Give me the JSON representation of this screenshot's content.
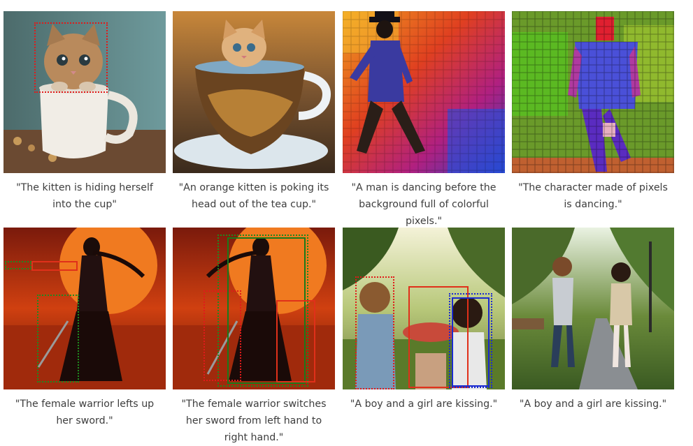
{
  "cards": [
    {
      "caption": "\"The kitten is hiding herself into the cup\""
    },
    {
      "caption": "\"An orange kitten is poking its head out of the tea cup.\""
    },
    {
      "caption": "\"A man is dancing before the background full of colorful pixels.\""
    },
    {
      "caption": "\"The character made of pixels is dancing.\""
    },
    {
      "caption": "\"The female warrior lefts up her sword.\""
    },
    {
      "caption": "\"The female warrior switches her sword from left hand to right hand.\""
    },
    {
      "caption": "\"A boy and a girl are kissing.\""
    },
    {
      "caption": "\"A boy and a girl are kissing.\""
    }
  ],
  "colors": {
    "box_red": "#e01a1a",
    "box_green": "#1f8a1f",
    "box_blue": "#1a2ad0",
    "caption_text": "#3d3d3d"
  }
}
